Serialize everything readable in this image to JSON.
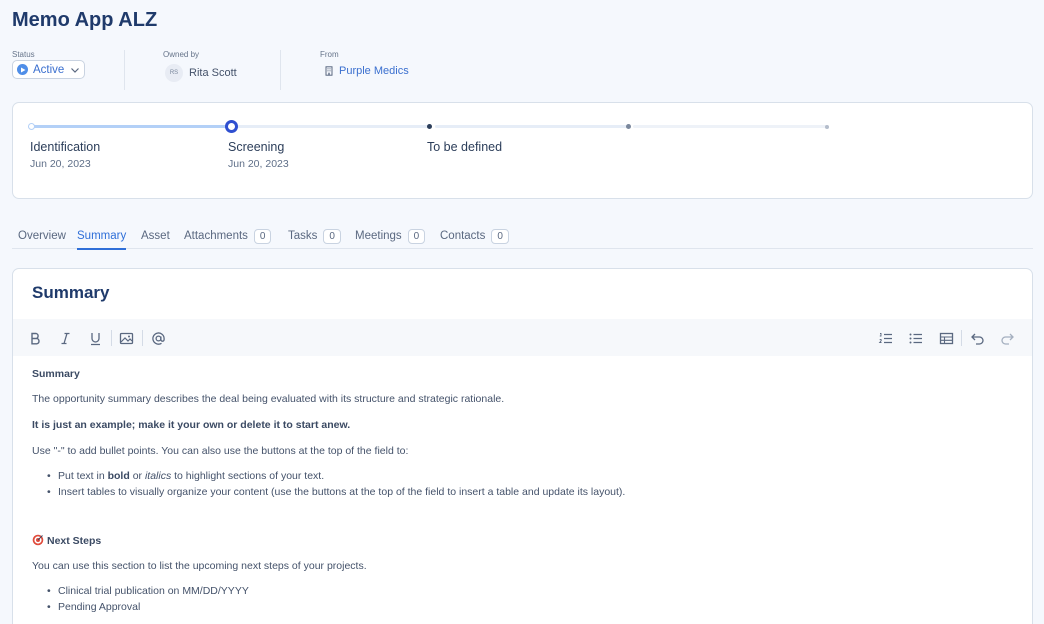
{
  "header": {
    "title": "Memo App ALZ",
    "status": {
      "label": "Status",
      "value": "Active"
    },
    "owner": {
      "label": "Owned by",
      "initials": "RS",
      "name": "Rita Scott"
    },
    "from": {
      "label": "From",
      "name": "Purple Medics"
    }
  },
  "stages": [
    {
      "name": "Identification",
      "date": "Jun 20, 2023"
    },
    {
      "name": "Screening",
      "date": "Jun 20, 2023"
    },
    {
      "name": "To be defined",
      "date": ""
    }
  ],
  "tabs": [
    {
      "label": "Overview",
      "count": null,
      "active": false
    },
    {
      "label": "Summary",
      "count": null,
      "active": true
    },
    {
      "label": "Asset",
      "count": null,
      "active": false
    },
    {
      "label": "Attachments",
      "count": "0",
      "active": false
    },
    {
      "label": "Tasks",
      "count": "0",
      "active": false
    },
    {
      "label": "Meetings",
      "count": "0",
      "active": false
    },
    {
      "label": "Contacts",
      "count": "0",
      "active": false
    }
  ],
  "editor": {
    "title": "Summary",
    "toolbar_left": [
      "bold-icon",
      "italic-icon",
      "underline-icon",
      "image-icon",
      "mention-icon"
    ],
    "toolbar_right": [
      "ordered-list-icon",
      "bullet-list-icon",
      "table-icon",
      "undo-icon",
      "redo-icon"
    ],
    "content": {
      "heading1": "Summary",
      "p1": "The opportunity summary describes the deal being evaluated with its structure and strategic rationale.",
      "p2": "It is just an example; make it your own or delete it to start anew.",
      "p3": "Use \"-\" to add bullet points. You can also use the buttons at the top of the field to:",
      "b1_pre": "Put text in ",
      "b1_bold": "bold",
      "b1_mid": " or ",
      "b1_italic": "italics",
      "b1_post": " to highlight sections of your text.",
      "b2": "Insert tables to visually organize your content (use the buttons at the top of the field to insert a table and update its layout).",
      "heading2": "Next Steps",
      "p4": "You can use this section to list the upcoming next steps of your projects.",
      "b3": "Clinical trial publication on MM/DD/YYYY",
      "b4": "Pending Approval"
    }
  },
  "colors": {
    "accent": "#2f6fd8",
    "title": "#1f3a6b",
    "progress": "#b3d0f7"
  }
}
